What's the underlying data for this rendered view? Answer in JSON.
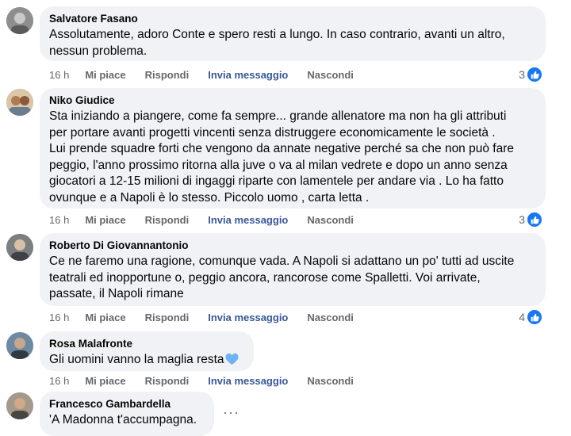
{
  "comments": [
    {
      "author": "Salvatore Fasano",
      "text": "Assolutamente, adoro Conte e spero resti a lungo. In caso contrario, avanti un altro,\nnessun problema.",
      "time": "16 h",
      "like": "Mi piace",
      "reply": "Rispondi",
      "message": "Invia messaggio",
      "hide": "Nascondi",
      "reactions": "3"
    },
    {
      "author": "Niko Giudice",
      "text": "Sta iniziando a piangere, come fa sempre... grande allenatore ma non ha gli attributi\nper portare avanti progetti vincenti senza distruggere economicamente le società .\nLui prende squadre forti che vengono da annate negative perché sa che non può fare\npeggio, l'anno prossimo ritorna alla juve o va al milan vedrete e dopo un anno senza\ngiocatori a 12-15 milioni di ingaggi riparte con lamentele per andare via . Lo ha fatto\novunque e a Napoli è lo stesso. Piccolo uomo , carta letta .",
      "time": "16 h",
      "like": "Mi piace",
      "reply": "Rispondi",
      "message": "Invia messaggio",
      "hide": "Nascondi",
      "reactions": "3"
    },
    {
      "author": "Roberto Di Giovannantonio",
      "text": "Ce ne faremo una ragione, comunque vada. A Napoli si adattano un po' tutti ad uscite\nteatrali ed inopportune o, peggio ancora, rancorose come Spalletti. Voi arrivate,\npassate, il Napoli rimane",
      "time": "16 h",
      "like": "Mi piace",
      "reply": "Rispondi",
      "message": "Invia messaggio",
      "hide": "Nascondi",
      "reactions": "4"
    },
    {
      "author": "Rosa Malafronte",
      "text": "Gli uomini vanno la maglia resta",
      "time": "16 h",
      "like": "Mi piace",
      "reply": "Rispondi",
      "message": "Invia messaggio",
      "hide": "Nascondi"
    },
    {
      "author": "Francesco Gambardella",
      "text": "'A Madonna t'accumpagna.",
      "more": "···"
    }
  ],
  "colors": {
    "like_blue": "#1877f2",
    "bubble": "#f0f2f5",
    "meta": "#65676b",
    "heart": "#6fb3f2"
  },
  "icons": {
    "like": "thumbs-up-icon",
    "heart": "blue-heart-icon",
    "more": "more-options-icon"
  }
}
